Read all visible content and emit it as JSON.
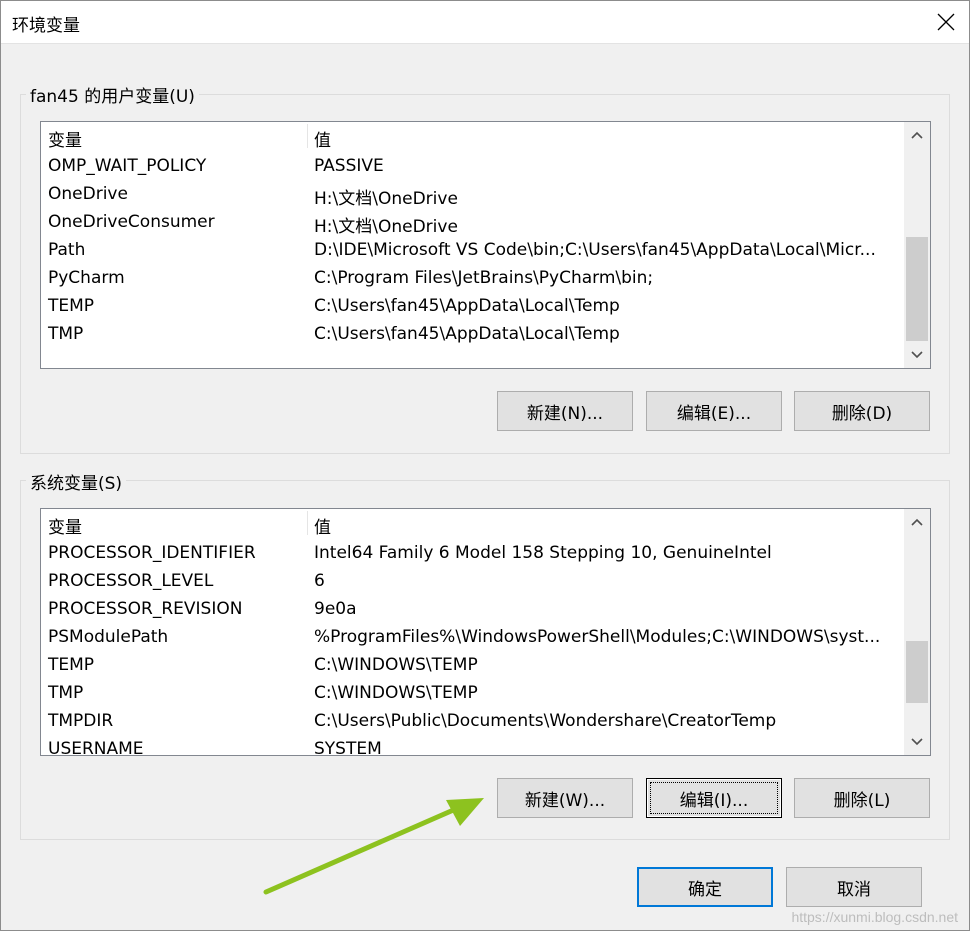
{
  "window": {
    "title": "环境变量"
  },
  "user_vars": {
    "group_label": "fan45 的用户变量(U)",
    "columns": [
      "变量",
      "值"
    ],
    "rows": [
      [
        "OMP_WAIT_POLICY",
        "PASSIVE"
      ],
      [
        "OneDrive",
        "H:\\文档\\OneDrive"
      ],
      [
        "OneDriveConsumer",
        "H:\\文档\\OneDrive"
      ],
      [
        "Path",
        "D:\\IDE\\Microsoft VS Code\\bin;C:\\Users\\fan45\\AppData\\Local\\Micr..."
      ],
      [
        "PyCharm",
        "C:\\Program Files\\JetBrains\\PyCharm\\bin;"
      ],
      [
        "TEMP",
        "C:\\Users\\fan45\\AppData\\Local\\Temp"
      ],
      [
        "TMP",
        "C:\\Users\\fan45\\AppData\\Local\\Temp"
      ]
    ],
    "buttons": {
      "new": "新建(N)...",
      "edit": "编辑(E)...",
      "delete": "删除(D)"
    }
  },
  "system_vars": {
    "group_label": "系统变量(S)",
    "columns": [
      "变量",
      "值"
    ],
    "rows": [
      [
        "PROCESSOR_IDENTIFIER",
        "Intel64 Family 6 Model 158 Stepping 10, GenuineIntel"
      ],
      [
        "PROCESSOR_LEVEL",
        "6"
      ],
      [
        "PROCESSOR_REVISION",
        "9e0a"
      ],
      [
        "PSModulePath",
        "%ProgramFiles%\\WindowsPowerShell\\Modules;C:\\WINDOWS\\syst..."
      ],
      [
        "TEMP",
        "C:\\WINDOWS\\TEMP"
      ],
      [
        "TMP",
        "C:\\WINDOWS\\TEMP"
      ],
      [
        "TMPDIR",
        "C:\\Users\\Public\\Documents\\Wondershare\\CreatorTemp"
      ],
      [
        "USERNAME",
        "SYSTEM"
      ]
    ],
    "buttons": {
      "new": "新建(W)...",
      "edit": "编辑(I)...",
      "delete": "删除(L)"
    }
  },
  "footer": {
    "ok": "确定",
    "cancel": "取消"
  },
  "watermark": "https://xunmi.blog.csdn.net",
  "colors": {
    "accent": "#0078d7",
    "annotation_arrow": "#8dc21f"
  },
  "icons": [
    "close-icon",
    "scroll-up-icon",
    "scroll-down-icon",
    "arrow-annotation"
  ]
}
